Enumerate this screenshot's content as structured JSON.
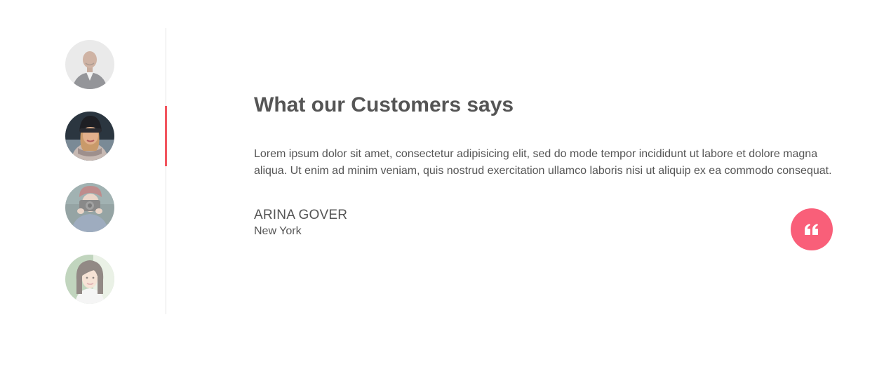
{
  "testimonials": {
    "title": "What our Customers says",
    "quote": "Lorem ipsum dolor sit amet, consectetur adipisicing elit, sed do mode tempor incididunt ut labore et dolore magna aliqua. Ut enim ad minim veniam, quis nostrud exercitation ullamco laboris nisi ut aliquip ex ea commodo consequat.",
    "author": {
      "name": "ARINA GOVER",
      "location": "New York"
    },
    "active_index": 1,
    "avatars": [
      {
        "icon": "avatar-man-bald"
      },
      {
        "icon": "avatar-woman-beanie"
      },
      {
        "icon": "avatar-woman-camera"
      },
      {
        "icon": "avatar-woman-asian"
      }
    ],
    "quote_icon": "quote-icon"
  },
  "colors": {
    "accent": "#f95f79",
    "active_bar": "#f2555f",
    "text": "#555555",
    "divider": "#e6e6e6"
  }
}
